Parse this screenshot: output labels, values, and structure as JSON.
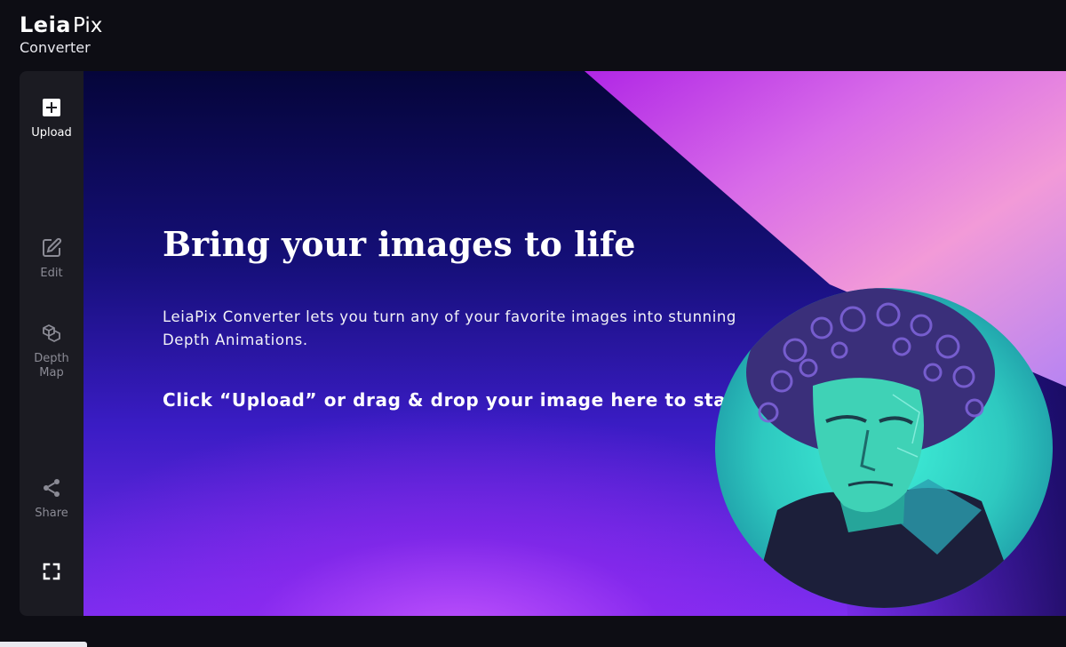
{
  "logo": {
    "brand": "Leia",
    "suffix": "Pix",
    "subtitle": "Converter"
  },
  "sidebar": {
    "items": [
      {
        "label": "Upload",
        "icon": "plus-box-icon",
        "active": true
      },
      {
        "label": "Edit",
        "icon": "pencil-box-icon",
        "active": false
      },
      {
        "label": "Depth\nMap",
        "icon": "layers-cube-icon",
        "active": false
      },
      {
        "label": "Share",
        "icon": "share-icon",
        "active": false
      },
      {
        "label": "",
        "icon": "fullscreen-icon",
        "active": false
      }
    ]
  },
  "hero": {
    "title": "Bring your images to life",
    "description": "LeiaPix Converter lets you turn any of your favorite images into stunning Depth Animations.",
    "cta": "Click “Upload” or drag & drop your image here to sta"
  },
  "colors": {
    "app_bg": "#0d0d14",
    "sidebar_bg": "#1b1b22",
    "active_label": "#ffffff",
    "inactive_label": "#8b8b95",
    "portrait_teal": "#34d8c6",
    "accent_violet": "#8a3cf0"
  }
}
